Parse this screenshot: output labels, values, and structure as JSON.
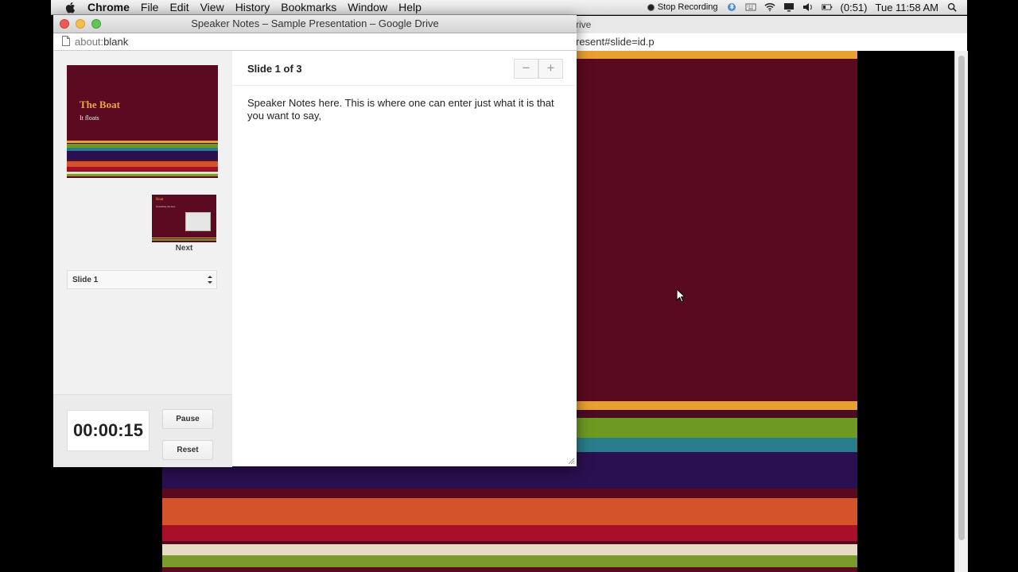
{
  "menubar": {
    "items": [
      "Chrome",
      "File",
      "Edit",
      "View",
      "History",
      "Bookmarks",
      "Window",
      "Help"
    ],
    "stop_recording": "Stop Recording",
    "battery": "(0:51)",
    "clock": "Tue 11:58 AM"
  },
  "background_window": {
    "tab_fragment": "rive",
    "url_fragment": "resent#slide=id.p"
  },
  "popup": {
    "window_title": "Speaker Notes – Sample Presentation – Google Drive",
    "url_prefix": "about:",
    "url_rest": "blank",
    "current_slide": {
      "title": "The Boat",
      "subtitle": "It floats"
    },
    "next_slide": {
      "title": "Boat",
      "subtitle": "Something else here"
    },
    "next_label": "Next",
    "slide_select_value": "Slide 1",
    "timer": "00:00:15",
    "pause_label": "Pause",
    "reset_label": "Reset",
    "slide_count": "Slide 1 of 3",
    "zoom_out": "−",
    "zoom_in": "+",
    "notes": "Speaker Notes here. This is where one can enter just what it is that you want to say,"
  },
  "colors": {
    "slide_bg": "#5a0a1e",
    "accent_orange": "#e8a030",
    "accent_green": "#6e9a22",
    "accent_teal": "#2a7d8c",
    "accent_purple": "#2a1050",
    "accent_red_orange": "#d4532a",
    "accent_red": "#a8102a"
  }
}
